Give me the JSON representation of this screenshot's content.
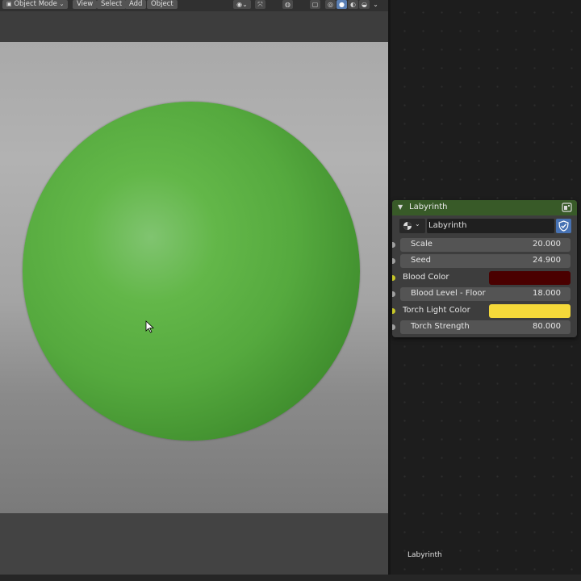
{
  "viewport": {
    "header": {
      "mode": "Object Mode",
      "menus": [
        "View",
        "Select",
        "Add",
        "Object"
      ]
    },
    "icons": [
      "visibility-icon",
      "gizmo-icon",
      "overlay-icon",
      "xray-icon",
      "wireframe-shading-icon",
      "solid-shading-icon",
      "material-shading-icon",
      "rendered-shading-icon"
    ],
    "sphere_color": "#56aa40"
  },
  "node": {
    "title": "Labyrinth",
    "header_color": "#385a28",
    "group_name": "Labyrinth",
    "inputs": [
      {
        "label": "Scale",
        "value": "20.000",
        "type": "float"
      },
      {
        "label": "Seed",
        "value": "24.900",
        "type": "float"
      },
      {
        "label": "Blood Color",
        "type": "color",
        "color": "#4a0000"
      },
      {
        "label": "Blood Level - Floor",
        "value": "18.000",
        "type": "float"
      },
      {
        "label": "Torch Light Color",
        "type": "color",
        "color": "#f5d93a"
      },
      {
        "label": "Torch Strength",
        "value": "80.000",
        "type": "float"
      }
    ]
  },
  "node_editor": {
    "tree_label": "Labyrinth"
  }
}
